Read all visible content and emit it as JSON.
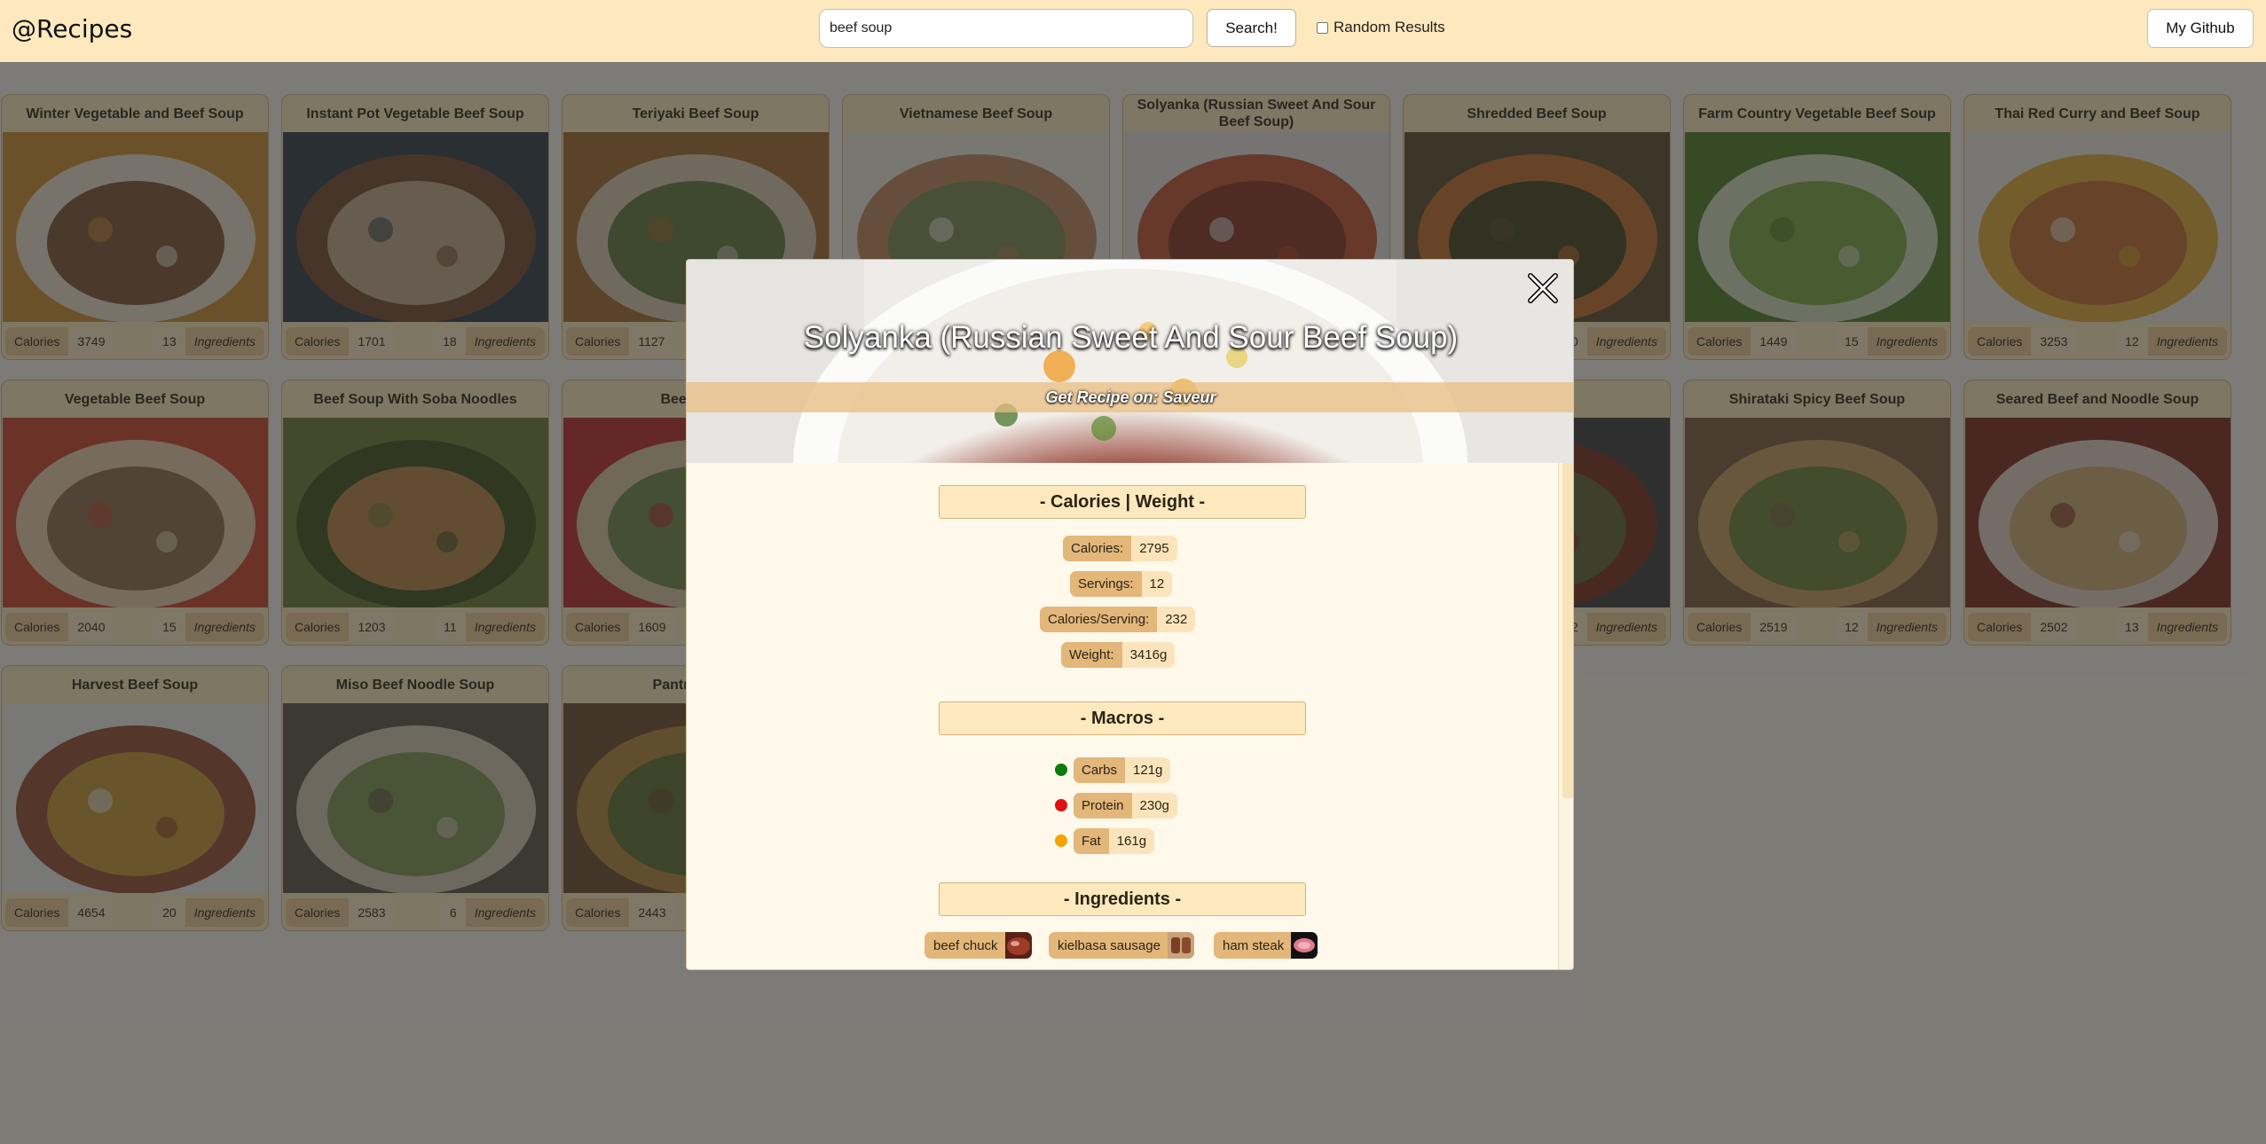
{
  "header": {
    "brand": "@Recipes",
    "search_value": "beef soup",
    "search_button": "Search!",
    "random_label": "Random Results",
    "github_label": "My Github"
  },
  "card_labels": {
    "calories": "Calories",
    "ingredients": "Ingredients"
  },
  "cards": [
    {
      "title": "Winter Vegetable and Beef Soup",
      "calories": "3749",
      "ingredients": "13"
    },
    {
      "title": "Instant Pot Vegetable Beef Soup",
      "calories": "1701",
      "ingredients": "18"
    },
    {
      "title": "Teriyaki Beef Soup",
      "calories": "1127",
      "ingredients": ""
    },
    {
      "title": "Vietnamese Beef Soup",
      "calories": "",
      "ingredients": ""
    },
    {
      "title": "Solyanka (Russian Sweet And Sour Beef Soup)",
      "calories": "",
      "ingredients": ""
    },
    {
      "title": "Shredded Beef Soup",
      "calories": "",
      "ingredients": "0"
    },
    {
      "title": "Farm Country Vegetable Beef Soup",
      "calories": "1449",
      "ingredients": "15"
    },
    {
      "title": "Thai Red Curry and Beef Soup",
      "calories": "3253",
      "ingredients": "12"
    },
    {
      "title": "Vegetable Beef Soup",
      "calories": "2040",
      "ingredients": "15"
    },
    {
      "title": "Beef Soup With Soba Noodles",
      "calories": "1203",
      "ingredients": "11"
    },
    {
      "title": "Beef Soup",
      "calories": "1609",
      "ingredients": ""
    },
    {
      "title": "",
      "calories": "",
      "ingredients": ""
    },
    {
      "title": "",
      "calories": "",
      "ingredients": ""
    },
    {
      "title": "oup",
      "calories": "",
      "ingredients": "2"
    },
    {
      "title": "Shirataki Spicy Beef Soup",
      "calories": "2519",
      "ingredients": "12"
    },
    {
      "title": "Seared Beef and Noodle Soup",
      "calories": "2502",
      "ingredients": "13"
    },
    {
      "title": "Harvest Beef Soup",
      "calories": "4654",
      "ingredients": "20"
    },
    {
      "title": "Miso Beef Noodle Soup",
      "calories": "2583",
      "ingredients": "6"
    },
    {
      "title": "Pantry Veget",
      "calories": "2443",
      "ingredients": ""
    }
  ],
  "modal": {
    "title": "Solyanka (Russian Sweet And Sour Beef Soup)",
    "recipe_link": "Get Recipe on: Saveur",
    "sections": {
      "calories_weight": "- Calories | Weight -",
      "macros": "- Macros -",
      "ingredients": "- Ingredients -"
    },
    "stats": [
      {
        "label": "Calories:",
        "value": "2795"
      },
      {
        "label": "Servings:",
        "value": "12"
      },
      {
        "label": "Calories/Serving:",
        "value": "232"
      },
      {
        "label": "Weight:",
        "value": "3416g"
      }
    ],
    "macros": [
      {
        "label": "Carbs",
        "value": "121g",
        "color": "#0a7d0a"
      },
      {
        "label": "Protein",
        "value": "230g",
        "color": "#e01010"
      },
      {
        "label": "Fat",
        "value": "161g",
        "color": "#f5a300"
      }
    ],
    "ingredients": [
      "beef chuck",
      "kielbasa sausage",
      "ham steak"
    ]
  }
}
